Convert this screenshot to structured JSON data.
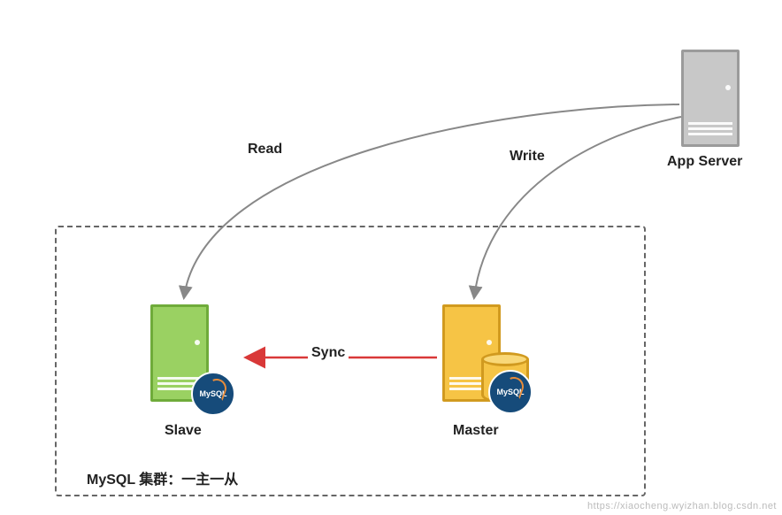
{
  "diagram": {
    "app_server_label": "App Server",
    "slave_label": "Slave",
    "master_label": "Master",
    "read_label": "Read",
    "write_label": "Write",
    "sync_label": "Sync",
    "cluster_caption": "MySQL 集群：一主一从",
    "mysql_badge_text": "MySQL",
    "watermark": "https://xiaocheng.wyizhan.blog.csdn.net"
  },
  "colors": {
    "app_server_fill": "#c8c8c8",
    "app_server_stroke": "#9b9b9b",
    "slave_fill": "#9ad162",
    "slave_stroke": "#6fab3a",
    "master_fill": "#f6c445",
    "master_stroke": "#d19a1f",
    "sync_arrow": "#d93838",
    "flow_arrow": "#888888",
    "badge": "#164b7a"
  },
  "chart_data": {
    "type": "diagram",
    "title": "MySQL 集群：一主一从",
    "nodes": [
      {
        "id": "app",
        "label": "App Server",
        "kind": "server",
        "color": "#c8c8c8"
      },
      {
        "id": "master",
        "label": "Master",
        "kind": "database",
        "color": "#f6c445"
      },
      {
        "id": "slave",
        "label": "Slave",
        "kind": "database",
        "color": "#9ad162"
      }
    ],
    "edges": [
      {
        "from": "app",
        "to": "slave",
        "label": "Read",
        "style": "curved",
        "color": "#888888"
      },
      {
        "from": "app",
        "to": "master",
        "label": "Write",
        "style": "curved",
        "color": "#888888"
      },
      {
        "from": "master",
        "to": "slave",
        "label": "Sync",
        "style": "straight",
        "color": "#d93838"
      }
    ],
    "groups": [
      {
        "label": "MySQL 集群：一主一从",
        "members": [
          "master",
          "slave"
        ]
      }
    ]
  }
}
